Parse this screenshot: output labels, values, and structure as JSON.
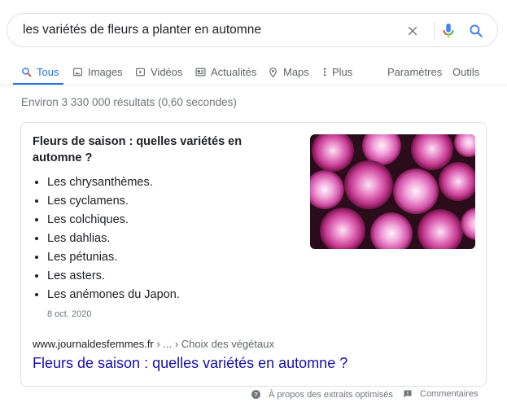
{
  "search": {
    "query": "les variétés de fleurs a planter en automne",
    "clear_icon": "close-icon",
    "mic_icon": "microphone-icon",
    "search_icon": "search-icon"
  },
  "tabs": [
    {
      "label": "Tous",
      "icon": "search-icon",
      "active": true
    },
    {
      "label": "Images",
      "icon": "image-icon"
    },
    {
      "label": "Vidéos",
      "icon": "video-icon"
    },
    {
      "label": "Actualités",
      "icon": "news-icon"
    },
    {
      "label": "Maps",
      "icon": "map-pin-icon"
    },
    {
      "label": "Plus",
      "icon": "more-vert-icon"
    },
    {
      "label": "Paramètres"
    },
    {
      "label": "Outils"
    }
  ],
  "stats": "Environ 3 330 000 résultats (0,60 secondes)",
  "snippet": {
    "title": "Fleurs de saison : quelles variétés en automne ?",
    "items": [
      "Les chrysanthèmes.",
      "Les cyclamens.",
      "Les colchiques.",
      "Les dahlias.",
      "Les pétunias.",
      "Les asters.",
      "Les anémones du Japon."
    ],
    "date": "8 oct. 2020",
    "site": "www.journaldesfemmes.fr",
    "path": " › ... › Choix des végétaux",
    "link_title": "Fleurs de saison : quelles variétés en automne ?",
    "image_subject": "pink chrysanthemum flowers"
  },
  "footer": {
    "about": "À propos des extraits optimisés",
    "feedback": "Commentaires"
  },
  "colors": {
    "link": "#1a0dab",
    "active_tab": "#1a73e8",
    "flower_pink": "#d64fa6"
  }
}
